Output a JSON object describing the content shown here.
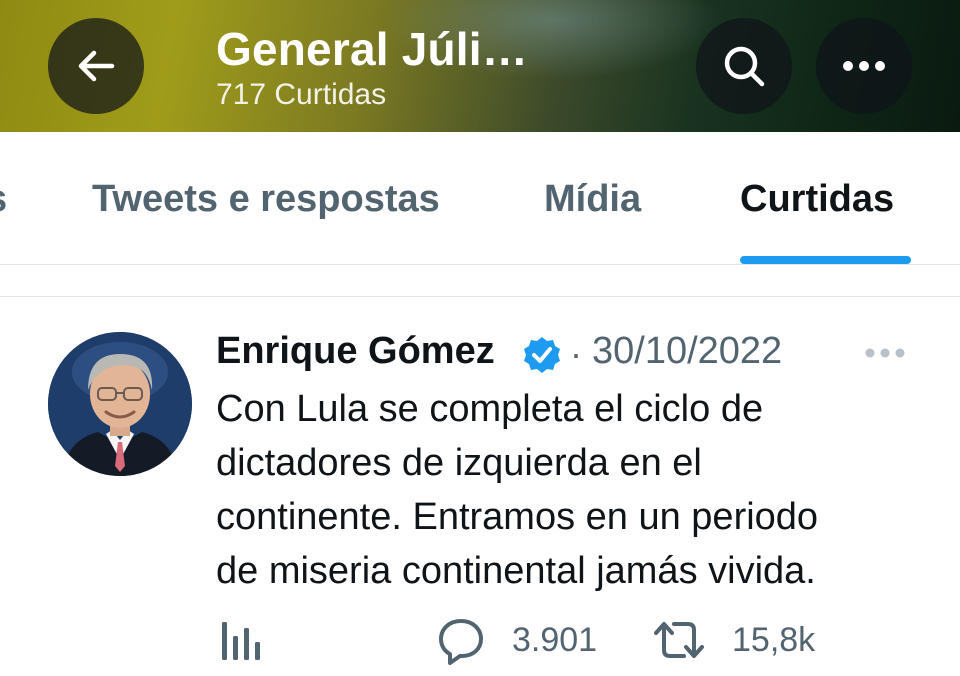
{
  "header": {
    "title": "General Júli…",
    "subtitle": "717 Curtidas"
  },
  "tabs": [
    {
      "label": "s"
    },
    {
      "label": "Tweets e respostas"
    },
    {
      "label": "Mídia"
    },
    {
      "label": "Curtidas",
      "active": true
    }
  ],
  "tweet": {
    "author": "Enrique Gómez",
    "separator": "·",
    "date": "30/10/2022",
    "text_lines": [
      "Con Lula se completa el ciclo de",
      "dictadores de izquierda en el",
      "continente. Entramos en un periodo",
      "de miseria continental jamás vivida."
    ],
    "replies": "3.901",
    "retweets": "15,8k"
  },
  "icons": {
    "back": "arrow-left-icon",
    "search": "search-icon",
    "more": "more-horizontal-icon",
    "verified": "verified-badge-icon",
    "views": "views-bar-chart-icon",
    "reply": "reply-bubble-icon",
    "retweet": "retweet-icon"
  },
  "colors": {
    "accent": "#1d9bf0",
    "verified": "#1d9bf0",
    "secondary_text": "#536471",
    "primary_text": "#0f1419"
  }
}
